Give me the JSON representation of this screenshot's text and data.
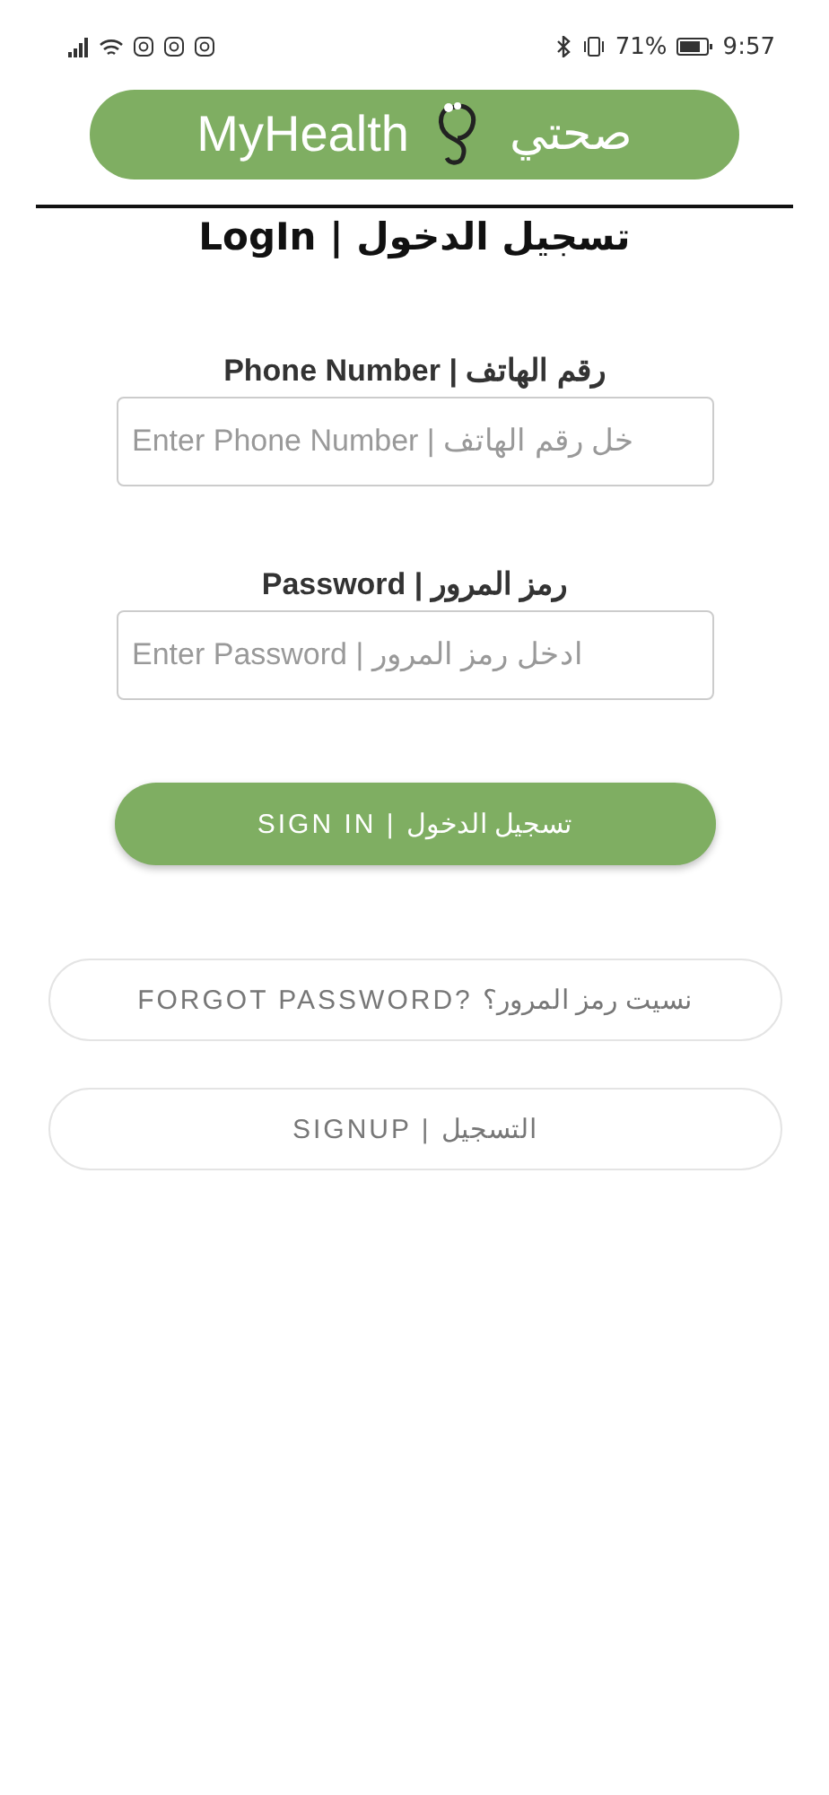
{
  "status_bar": {
    "battery": "71%",
    "time": "9:57"
  },
  "logo": {
    "name_en": "MyHealth",
    "name_ar": "صحتي"
  },
  "title": "LogIn | تسجيل الدخول",
  "fields": [
    {
      "label": "Phone Number | رقم الهاتف",
      "placeholder": "Enter Phone Number | خل رقم الهاتف"
    },
    {
      "label": "Password | رمز المرور",
      "placeholder": "Enter Password | ادخل رمز المرور"
    }
  ],
  "buttons": [
    {
      "kind": "primary",
      "label": "SIGN IN | تسجيل الدخول"
    },
    {
      "kind": "outline",
      "label": "FORGOT PASSWORD? نسيت رمز المرور؟"
    },
    {
      "kind": "outline",
      "label": "SIGNUP | التسجيل"
    }
  ]
}
